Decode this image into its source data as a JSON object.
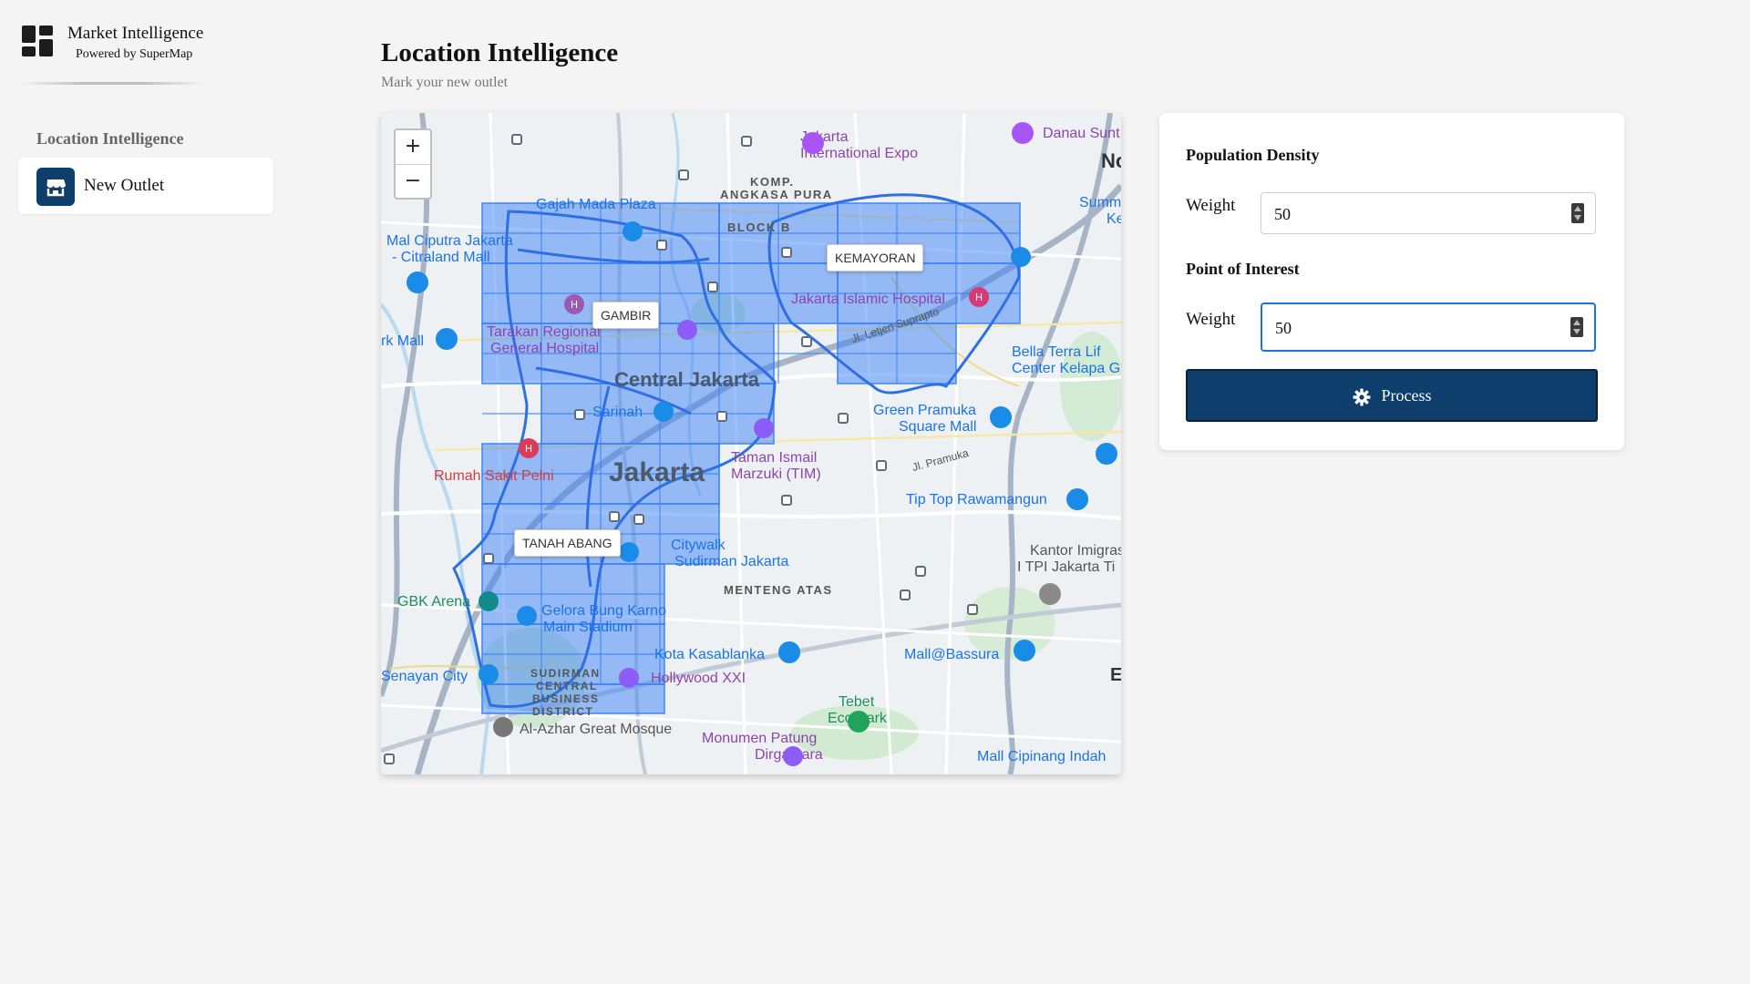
{
  "brand": {
    "title": "Market Intelligence",
    "subtitle": "Powered by SuperMap"
  },
  "sidebar": {
    "section_label": "Location Intelligence",
    "items": [
      {
        "label": "New Outlet",
        "icon": "store-icon"
      }
    ]
  },
  "header": {
    "title": "Location Intelligence",
    "subtitle": "Mark your new outlet"
  },
  "map": {
    "zoom_in": "+",
    "zoom_out": "−",
    "districts": [
      "KEMAYORAN",
      "GAMBIR",
      "TANAH ABANG"
    ],
    "labels": {
      "jakarta_fair": "Jakarta",
      "jakarta_fair_2": "International Expo",
      "danau_sunter": "Danau Sunt",
      "komp_angkasa": "KOMP.",
      "komp_angkasa_2": "ANGKASA PURA",
      "gajah_mada": "Gajah Mada Plaza",
      "blok_b": "BLOCK B",
      "mal_ciputra": "Mal Ciputra Jakarta",
      "citraland": "- Citraland Mall",
      "islamic_hosp": "Jakarta Islamic Hospital",
      "tarakan": "Tarakan Regional",
      "tarakan_2": "General Hospital",
      "ark_mall": "rk Mall",
      "central_jakarta": "Central Jakarta",
      "sarinah": "Sarinah",
      "jakarta": "Jakarta",
      "green_pramuka": "Green Pramuka",
      "green_pramuka_2": "Square Mall",
      "bella_terra": "Bella Terra Lif",
      "bella_terra_2": "Center Kelapa G",
      "rs_pelni": "Rumah Sakit Pelni",
      "tim": "Taman Ismail",
      "tim_2": "Marzuki (TIM)",
      "jl_pramuka": "Jl. Pramuka",
      "tip_top": "Tip Top Rawamangun",
      "citywalk": "Citywalk",
      "citywalk_2": "Sudirman Jakarta",
      "kantor_imigrasi": "Kantor Imigras",
      "kantor_imigrasi_2": "I TPI Jakarta Ti",
      "menteng": "MENTENG ATAS",
      "gbk_arena": "GBK Arena",
      "gelora": "Gelora Bung Karno",
      "gelora_2": "Main Stadium",
      "kota_kasablanka": "Kota Kasablanka",
      "mall_bassura": "Mall@Bassura",
      "senayan_city": "Senayan City",
      "scbd": "SUDIRMAN",
      "scbd_2": "CENTRAL",
      "scbd_3": "BUSINESS",
      "scbd_4": "DISTRICT",
      "hollywood": "Hollywood XXI",
      "tebet": "Tebet",
      "tebet_2": "Eco Park",
      "al_azhar": "Al-Azhar Great Mosque",
      "monumen": "Monumen Patung",
      "monumen_2": "Dirgantara",
      "mall_cipinang": "Mall Cipinang Indah",
      "summ": "Summ",
      "summ_2": "Ke",
      "jl_letjen": "Jl. Letjen Suprapto",
      "no": "No",
      "e": "E"
    }
  },
  "panel": {
    "population": {
      "title": "Population Density",
      "weight_label": "Weight",
      "weight_value": "50"
    },
    "poi": {
      "title": "Point of Interest",
      "weight_label": "Weight",
      "weight_value": "50"
    },
    "process_label": "Process",
    "accent": "#0d3e6c",
    "focus": "#1a73e8"
  },
  "grid_fill": "#3b82f6"
}
